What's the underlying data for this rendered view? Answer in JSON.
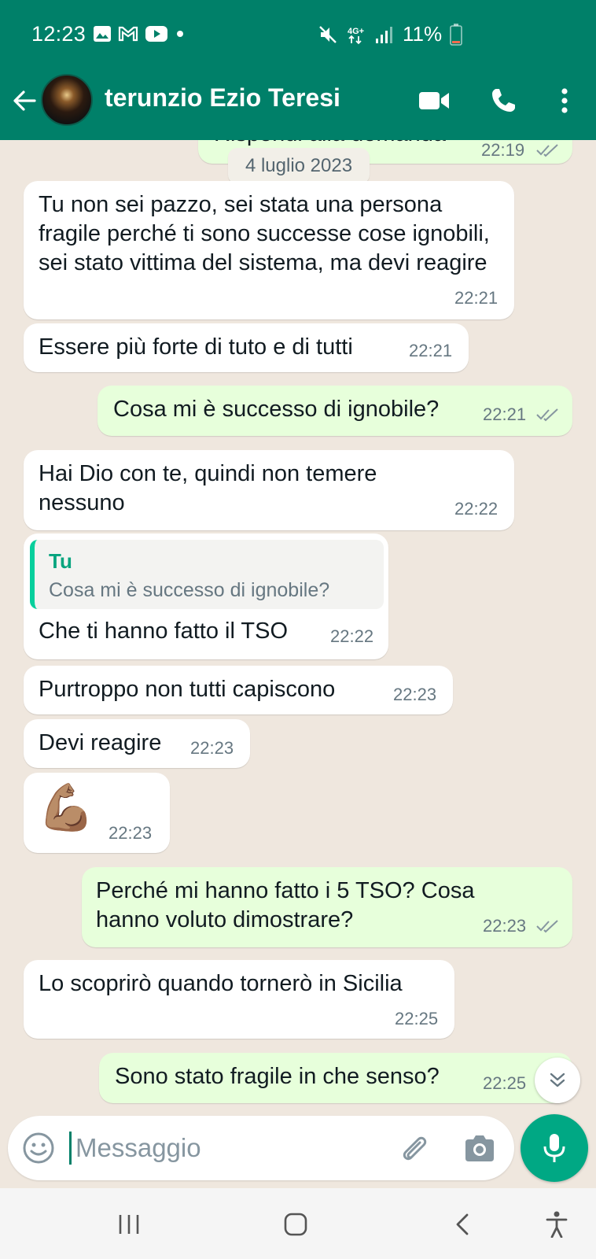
{
  "status_bar": {
    "time": "12:23",
    "battery": "11%",
    "left_icons": [
      "image-icon",
      "gmail-icon",
      "youtube-icon",
      "dot-icon"
    ],
    "right_icons": [
      "mute-icon",
      "4g-icon",
      "signal-icon",
      "battery-icon"
    ]
  },
  "header": {
    "contact_name": "terunzio Ezio Teresi",
    "actions": [
      "video-call-icon",
      "phone-icon",
      "more-icon"
    ]
  },
  "chat": {
    "partial_message": {
      "text": "Rispondi alla domanda",
      "time": "22:19"
    },
    "date_chip": "4 luglio 2023",
    "messages": [
      {
        "dir": "in",
        "text": "Tu non sei pazzo, sei stata una persona fragile perché ti sono successe cose ignobili, sei stato vittima del sistema, ma devi reagire",
        "time": "22:21"
      },
      {
        "dir": "in",
        "text": "Essere più forte di tuto e di tutti",
        "time": "22:21"
      },
      {
        "dir": "out",
        "text": "Cosa mi è successo di ignobile?",
        "time": "22:21"
      },
      {
        "dir": "in",
        "text": "Hai Dio con te, quindi non temere nessuno",
        "time": "22:22"
      },
      {
        "dir": "in",
        "reply_author": "Tu",
        "reply_text": "Cosa mi è successo di ignobile?",
        "text": "Che ti hanno fatto il TSO",
        "time": "22:22"
      },
      {
        "dir": "in",
        "text": "Purtroppo non tutti capiscono",
        "time": "22:23"
      },
      {
        "dir": "in",
        "text": "Devi reagire",
        "time": "22:23"
      },
      {
        "dir": "in",
        "emoji": "💪🏽",
        "time": "22:23"
      },
      {
        "dir": "out",
        "text": "Perché mi hanno fatto i 5 TSO? Cosa hanno voluto dimostrare?",
        "time": "22:23"
      },
      {
        "dir": "in",
        "text": "Lo scoprirò quando tornerò in Sicilia",
        "time": "22:25"
      },
      {
        "dir": "out",
        "text": "Sono stato fragile in che senso?",
        "time": "22:25"
      }
    ]
  },
  "input": {
    "placeholder": "Messaggio"
  },
  "colors": {
    "brand": "#008069",
    "accent": "#00a884",
    "outgoing": "#e7ffdb",
    "incoming": "#ffffff",
    "background": "#efe7de",
    "read_ticks": "#667781"
  },
  "nav_bar": {
    "buttons": [
      "recent-apps-icon",
      "home-icon",
      "back-icon",
      "accessibility-icon"
    ]
  }
}
